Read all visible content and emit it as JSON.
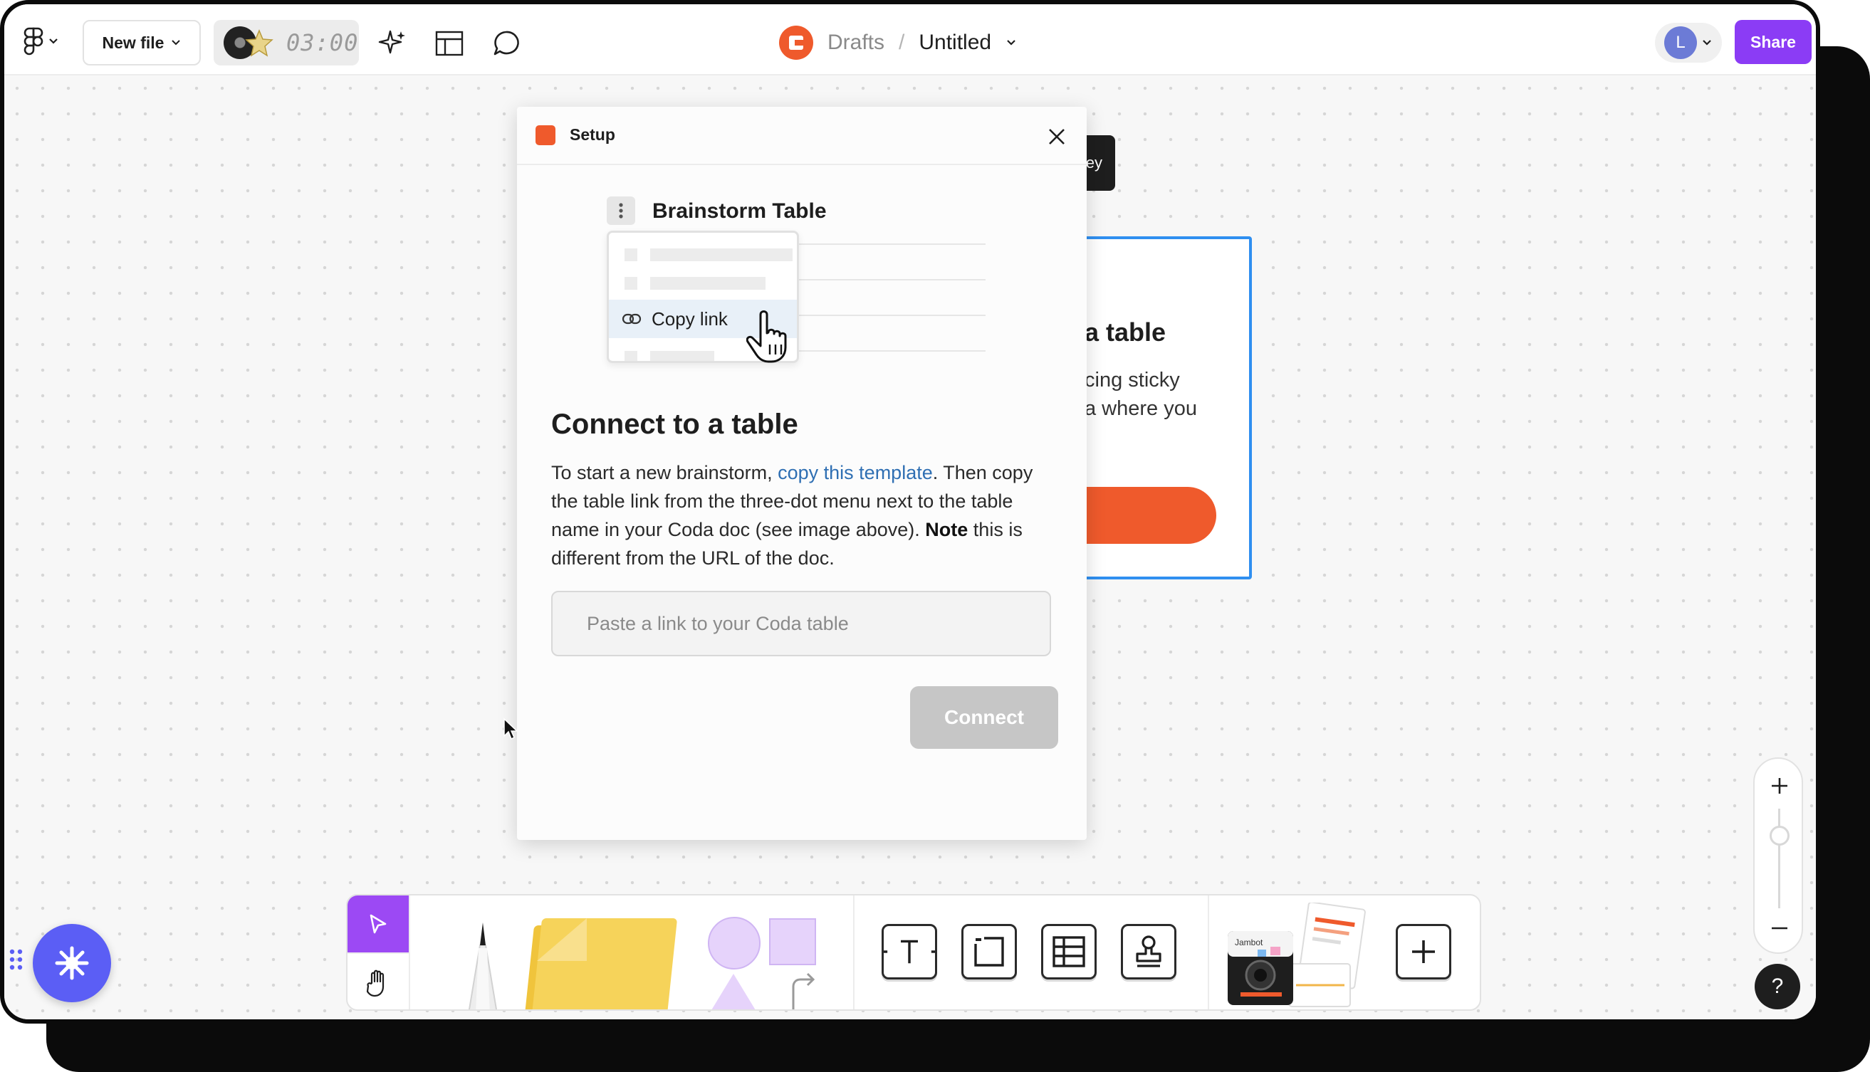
{
  "topbar": {
    "new_file_label": "New file",
    "timer_text": "03:00",
    "breadcrumb": {
      "parent": "Drafts",
      "separator": "/",
      "title": "Untitled"
    },
    "avatar_initial": "L",
    "share_label": "Share"
  },
  "background_card": {
    "tooltip_text": "ey",
    "title_partial": "a table",
    "line1_partial": "cing sticky",
    "line2_partial": "a where you"
  },
  "modal": {
    "title": "Setup",
    "illustration": {
      "table_title": "Brainstorm Table",
      "menu_item": "Copy link"
    },
    "heading": "Connect to a table",
    "body": {
      "part1": "To start a new brainstorm, ",
      "link": "copy this template",
      "part2": ". Then copy the table link from the three-dot menu next to the table name in your Coda doc (see image above). ",
      "note_bold": "Note",
      "part3": " this is different from the URL of the doc."
    },
    "input_placeholder": "Paste a link to your Coda table",
    "input_value": "",
    "connect_label": "Connect"
  },
  "toolbar": {
    "widget_brand": "Jambot"
  },
  "help_label": "?",
  "colors": {
    "share": "#8b3cf5",
    "coda_brand": "#ef5a2c",
    "link": "#2f6fb3",
    "selection": "#2f8ff0",
    "plugin_button": "#5b5ef5"
  }
}
